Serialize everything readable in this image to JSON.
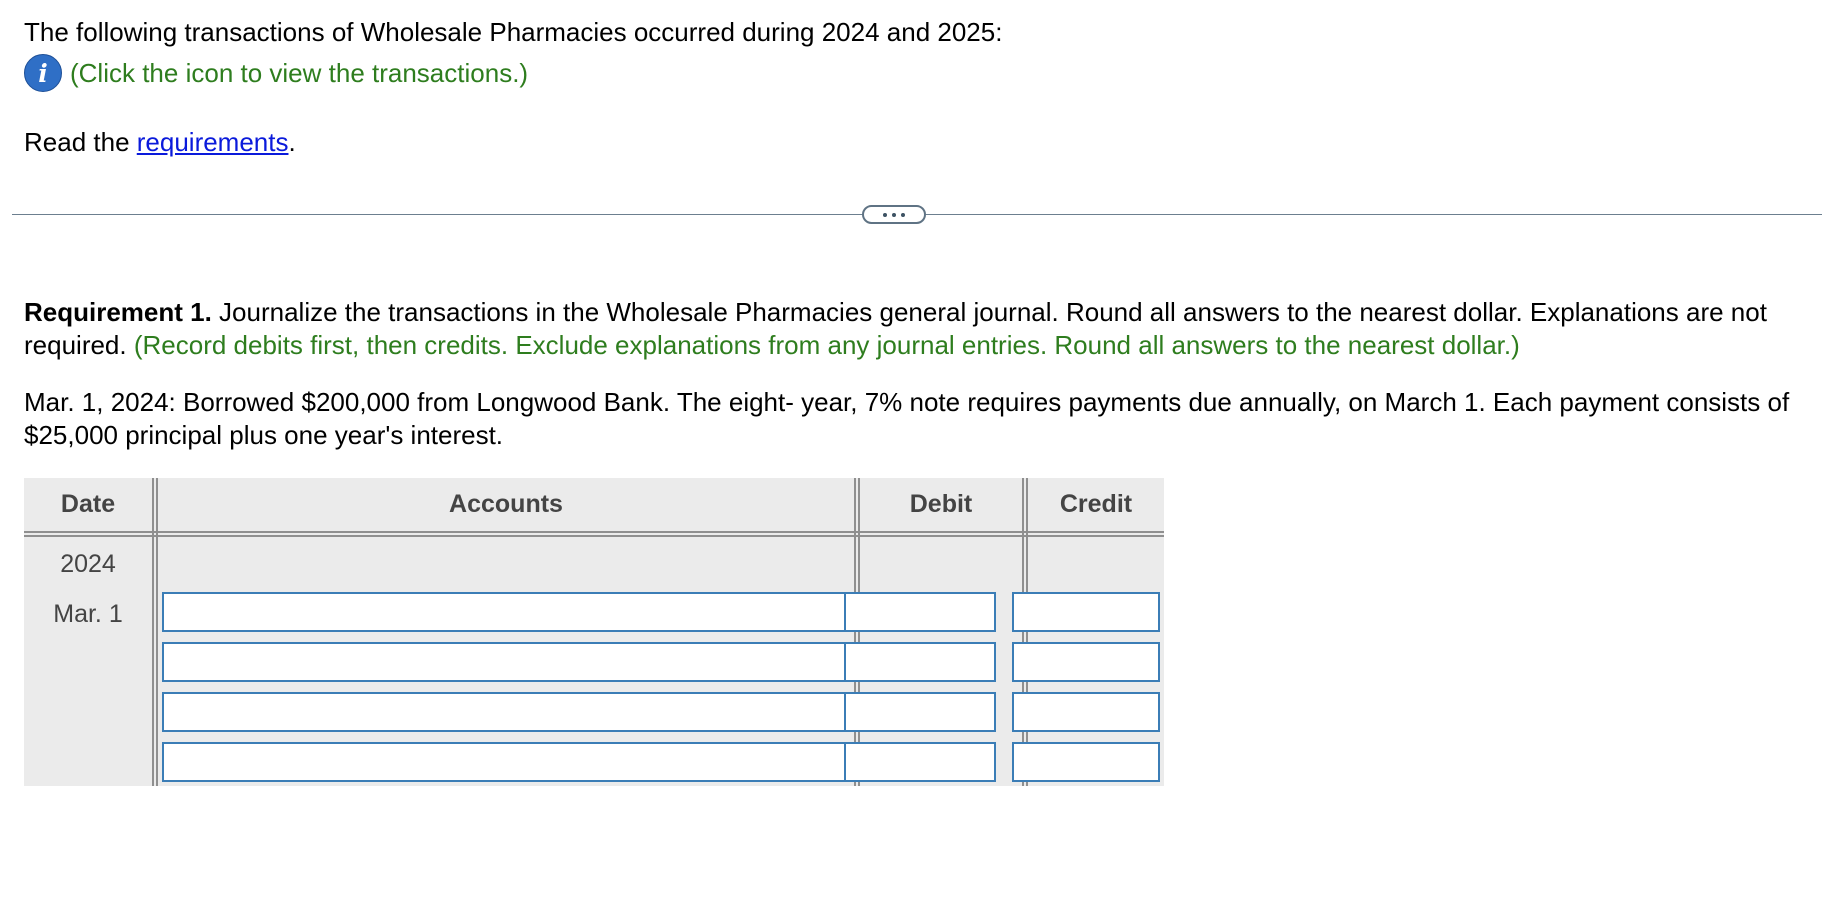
{
  "intro": {
    "text": "The following transactions of Wholesale Pharmacies occurred during 2024 and 2025:",
    "info_icon": "info-icon",
    "click_text": "(Click the icon to view the transactions.)"
  },
  "read": {
    "prefix": "Read the ",
    "link": "requirements",
    "suffix": "."
  },
  "divider": {
    "icon": "more-dots-icon"
  },
  "requirement": {
    "label": "Requirement 1.",
    "text": " Journalize the transactions in the Wholesale Pharmacies general journal. Round all answers to the nearest dollar. Explanations are not required. ",
    "note": "(Record debits first, then credits. Exclude explanations from any journal entries. Round all answers to the nearest dollar.)"
  },
  "transaction": {
    "text": "Mar. 1, 2024: Borrowed $200,000 from Longwood Bank. The eight- year, 7% note requires payments due annually, on March 1. Each payment consists of $25,000 principal plus one year's interest."
  },
  "journal": {
    "headers": {
      "date": "Date",
      "accounts": "Accounts",
      "debit": "Debit",
      "credit": "Credit"
    },
    "year": "2024",
    "date": "Mar. 1",
    "rows": [
      {
        "account": "",
        "debit": "",
        "credit": ""
      },
      {
        "account": "",
        "debit": "",
        "credit": ""
      },
      {
        "account": "",
        "debit": "",
        "credit": ""
      },
      {
        "account": "",
        "debit": "",
        "credit": ""
      }
    ]
  },
  "colors": {
    "note_green": "#2e7d1e",
    "link_blue": "#0a1adb",
    "info_icon_blue": "#2f6fc6",
    "input_border": "#3b7db6",
    "table_bg": "#ebebeb"
  }
}
